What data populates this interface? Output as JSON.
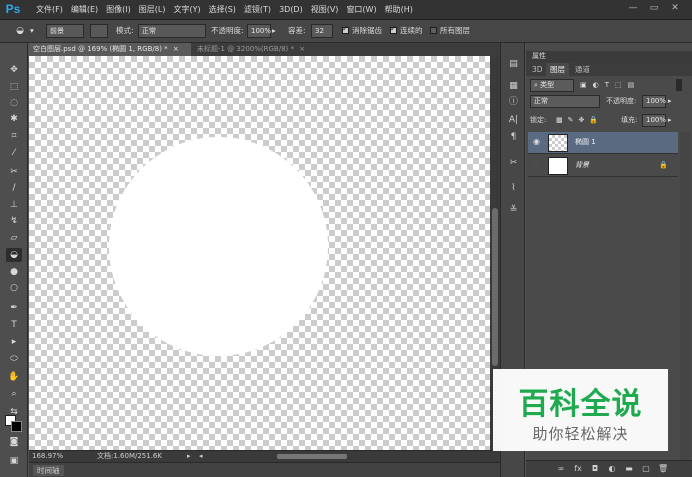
{
  "app": {
    "logo": "Ps"
  },
  "menu": [
    "文件(F)",
    "编辑(E)",
    "图像(I)",
    "图层(L)",
    "文字(Y)",
    "选择(S)",
    "滤镜(T)",
    "3D(D)",
    "视图(V)",
    "窗口(W)",
    "帮助(H)"
  ],
  "window_controls": {
    "minimize": "—",
    "restore": "▭",
    "close": "✕"
  },
  "options": {
    "tool_icon": "paint-bucket-icon",
    "fill_source": "前景",
    "mode_label": "模式:",
    "mode_value": "正常",
    "opacity_label": "不透明度:",
    "opacity_value": "100%",
    "tolerance_label": "容差:",
    "tolerance_value": "32",
    "antialias_label": "消除锯齿",
    "contiguous_label": "连续的",
    "all_layers_label": "所有图层"
  },
  "tabs": [
    {
      "label": "空白图层.psd @ 169% (椭圆 1, RGB/8) *",
      "close": "×"
    },
    {
      "label": "未标题-1 @ 3200%(RGB/8) *",
      "close": "×"
    }
  ],
  "status": {
    "zoom": "168.97%",
    "doc": "文档:1.60M/251.6K"
  },
  "timeline": {
    "label": "时间轴"
  },
  "panel": {
    "title": "属性",
    "tabs": [
      "3D",
      "图层",
      "通道"
    ],
    "kind_label": "类型",
    "blend_mode": "正常",
    "opacity_label": "不透明度:",
    "opacity_value": "100%",
    "lock_label": "锁定:",
    "fill_label": "填充:",
    "fill_value": "100%",
    "layers": [
      {
        "name": "椭圆 1",
        "selected": true
      },
      {
        "name": "背景",
        "selected": false
      }
    ],
    "footer_icons": [
      "link-icon",
      "fx-icon",
      "mask-icon",
      "adjustment-icon",
      "folder-icon",
      "new-layer-icon",
      "trash-icon"
    ]
  },
  "watermark": {
    "title": "百科全说",
    "subtitle": "助你轻松解决"
  },
  "colors": {
    "accent": "#2ea8e6",
    "watermark_green": "#1faa4f",
    "selected_layer": "#5a6a80"
  }
}
